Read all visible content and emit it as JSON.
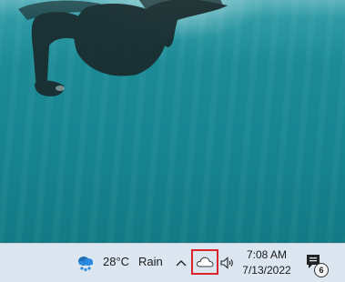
{
  "desktop": {
    "wallpaper": "underwater-swimmer-wallpaper",
    "water_color": "#1c8b96"
  },
  "taskbar": {
    "weather": {
      "icon": "rain-cloud-icon",
      "temperature": "28°C",
      "condition": "Rain"
    },
    "tray": {
      "overflow_chevron": "^",
      "onedrive_icon": "cloud-icon",
      "volume_icon": "speaker-icon"
    },
    "clock": {
      "time": "7:08 AM",
      "date": "7/13/2022"
    },
    "notifications": {
      "icon": "notification-center-icon",
      "count": "6"
    },
    "highlight_color": "#d7262d",
    "background": "#dce6f1"
  }
}
